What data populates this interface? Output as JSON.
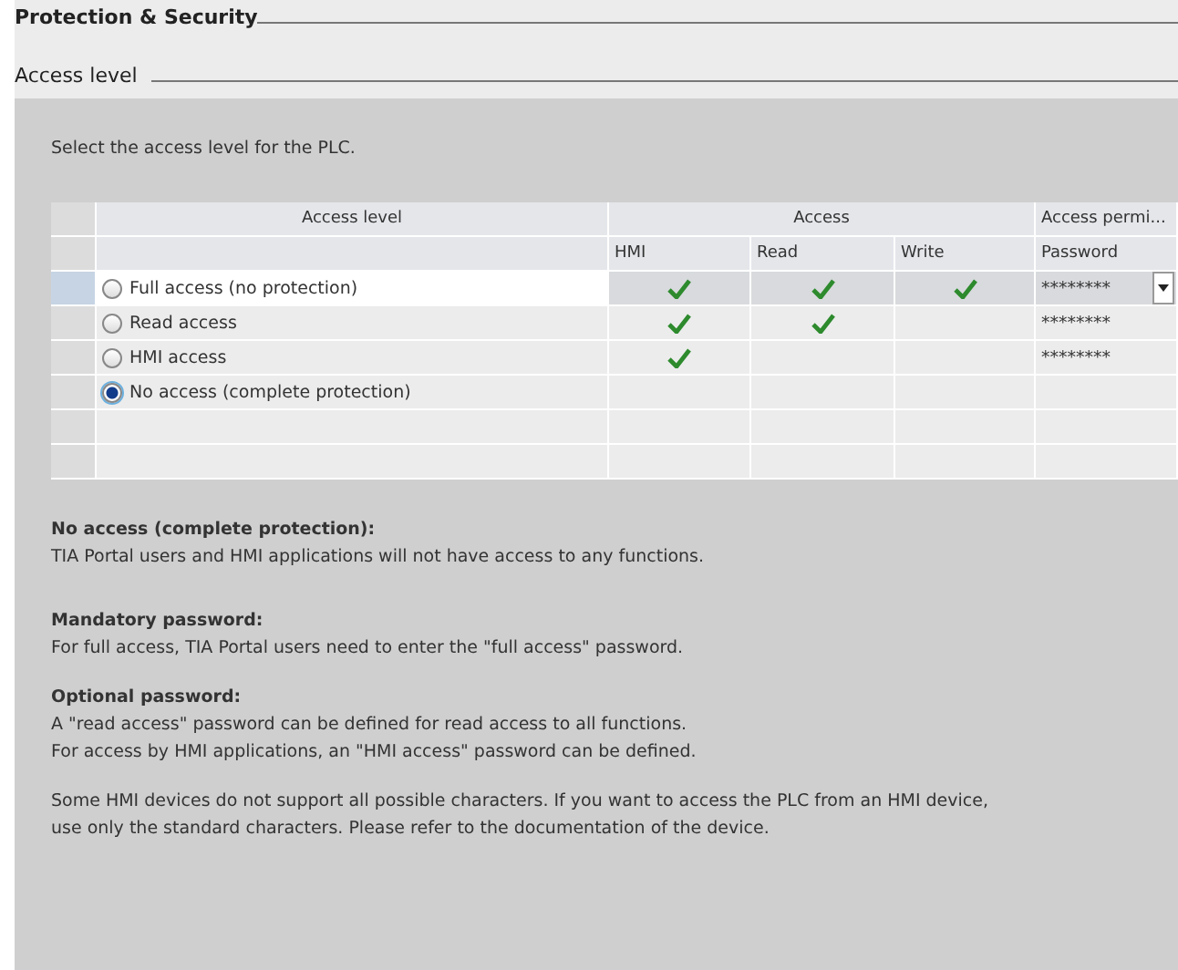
{
  "section_title": "Protection & Security",
  "subsection_title": "Access level",
  "instruction": "Select the access level for the PLC.",
  "table": {
    "columns": [
      {
        "label": "Access level"
      },
      {
        "label": "Access"
      },
      {
        "label": "Access permi..."
      }
    ],
    "subcolumns": [
      "HMI",
      "Read",
      "Write",
      "Password"
    ],
    "rows": [
      {
        "label": "Full access (no protection)",
        "selected": false,
        "highlighted": true,
        "hmi": true,
        "read": true,
        "write": true,
        "password": "********"
      },
      {
        "label": "Read access",
        "selected": false,
        "highlighted": false,
        "hmi": true,
        "read": true,
        "write": false,
        "password": "********"
      },
      {
        "label": "HMI access",
        "selected": false,
        "highlighted": false,
        "hmi": true,
        "read": false,
        "write": false,
        "password": "********"
      },
      {
        "label": "No access (complete protection)",
        "selected": true,
        "highlighted": false,
        "hmi": false,
        "read": false,
        "write": false
      }
    ]
  },
  "notes": [
    {
      "heading": "No access (complete protection):",
      "lines": [
        "TIA Portal users and HMI applications will not have access to any functions."
      ]
    },
    {
      "heading": "Mandatory password:",
      "lines": [
        "For full access, TIA Portal users need to enter the \"full access\" password."
      ]
    },
    {
      "heading": "Optional password:",
      "lines": [
        "A \"read access\" password can be defined for read access to all functions.",
        "For access by HMI applications, an \"HMI access\" password can be defined."
      ]
    },
    {
      "lines": [
        "Some HMI devices do not support all possible characters. If you want to access the PLC from an HMI device,",
        "use only the standard characters. Please refer to the documentation of the device."
      ]
    }
  ]
}
